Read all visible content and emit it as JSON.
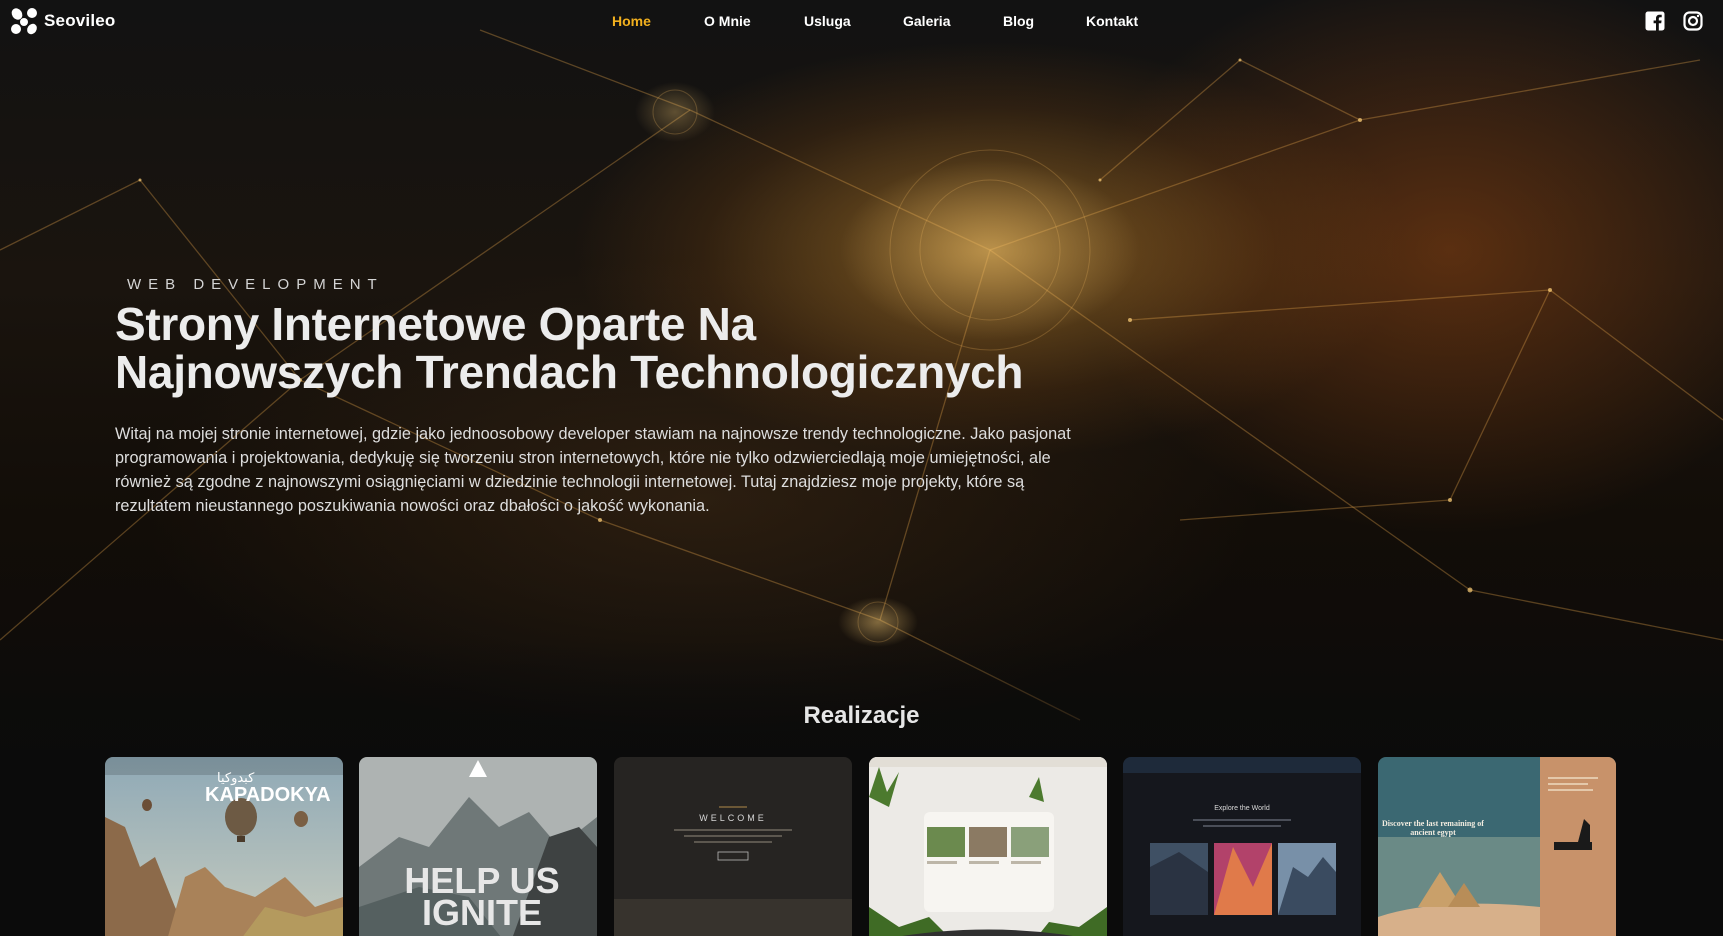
{
  "brand": {
    "name": "Seovileo"
  },
  "nav": {
    "items": [
      {
        "label": "Home",
        "active": true
      },
      {
        "label": "O Mnie",
        "active": false
      },
      {
        "label": "Usluga",
        "active": false
      },
      {
        "label": "Galeria",
        "active": false
      },
      {
        "label": "Blog",
        "active": false
      },
      {
        "label": "Kontakt",
        "active": false
      }
    ]
  },
  "social": {
    "icons": [
      "facebook-icon",
      "instagram-icon"
    ]
  },
  "hero": {
    "eyebrow": "WEB DEVELOPMENT",
    "title_line1": "Strony Internetowe Oparte Na",
    "title_line2": "Najnowszych Trendach Technologicznych",
    "intro": "Witaj na mojej stronie internetowej, gdzie jako jednoosobowy developer stawiam na najnowsze trendy technologiczne. Jako pasjonat programowania i projektowania, dedykuję się tworzeniu stron internetowych, które nie tylko odzwierciedlają moje umiejętności, ale również są zgodne z najnowszymi osiągnięciami w dziedzinie technologii internetowej. Tutaj znajdziesz moje projekty, które są rezultatem nieustannego poszukiwania nowości oraz dbałości o jakość wykonania."
  },
  "portfolio": {
    "title": "Realizacje",
    "cards": [
      {
        "overlay": "KAPADOKYA",
        "overlay_small": "كبدوكيا"
      },
      {
        "overlay": "HELP US IGNITE"
      },
      {
        "overlay": "WELCOME"
      },
      {
        "overlay": ""
      },
      {
        "overlay": "Explore the World"
      },
      {
        "overlay": "Discover the last remaining of ancient egypt"
      }
    ]
  },
  "colors": {
    "accent": "#f2b01e",
    "background": "#0b0b0b",
    "text": "#ffffff"
  }
}
